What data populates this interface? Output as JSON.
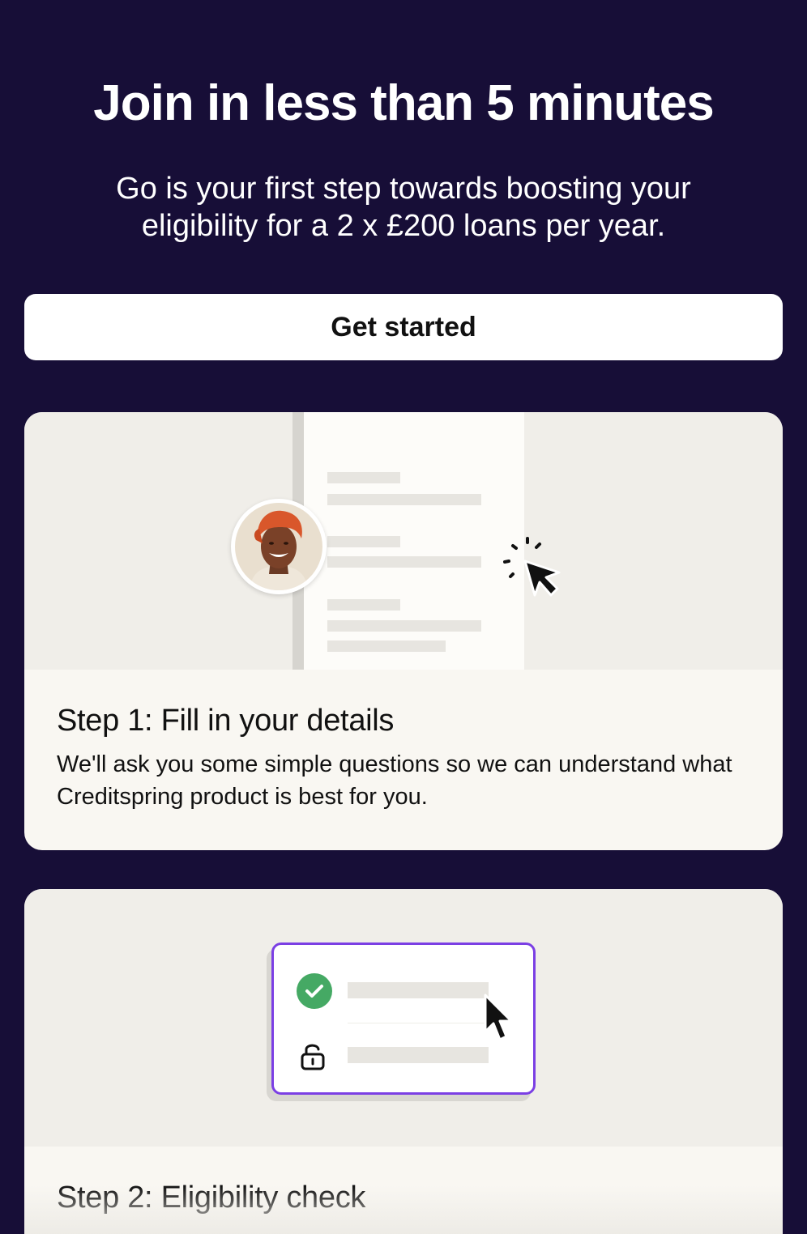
{
  "hero": {
    "title": "Join in less than 5 minutes",
    "subtitle": "Go is your first step towards boosting your eligibility for a 2 x £200 loans per year."
  },
  "cta": {
    "label": "Get started"
  },
  "steps": [
    {
      "title": "Step 1: Fill in your details",
      "description": "We'll ask you some simple questions so we can understand what Creditspring product is best for you.",
      "illustration": [
        "form-document",
        "avatar",
        "click-cursor-icon"
      ]
    },
    {
      "title": "Step 2: Eligibility check",
      "illustration": [
        "checklist-card",
        "check-icon",
        "unlock-icon",
        "arrow-cursor-icon"
      ]
    }
  ],
  "colors": {
    "background": "#170e37",
    "card": "#f9f7f2",
    "illustration_bg": "#f0eee9",
    "accent_purple": "#7b3fe4",
    "success_green": "#45a964"
  }
}
